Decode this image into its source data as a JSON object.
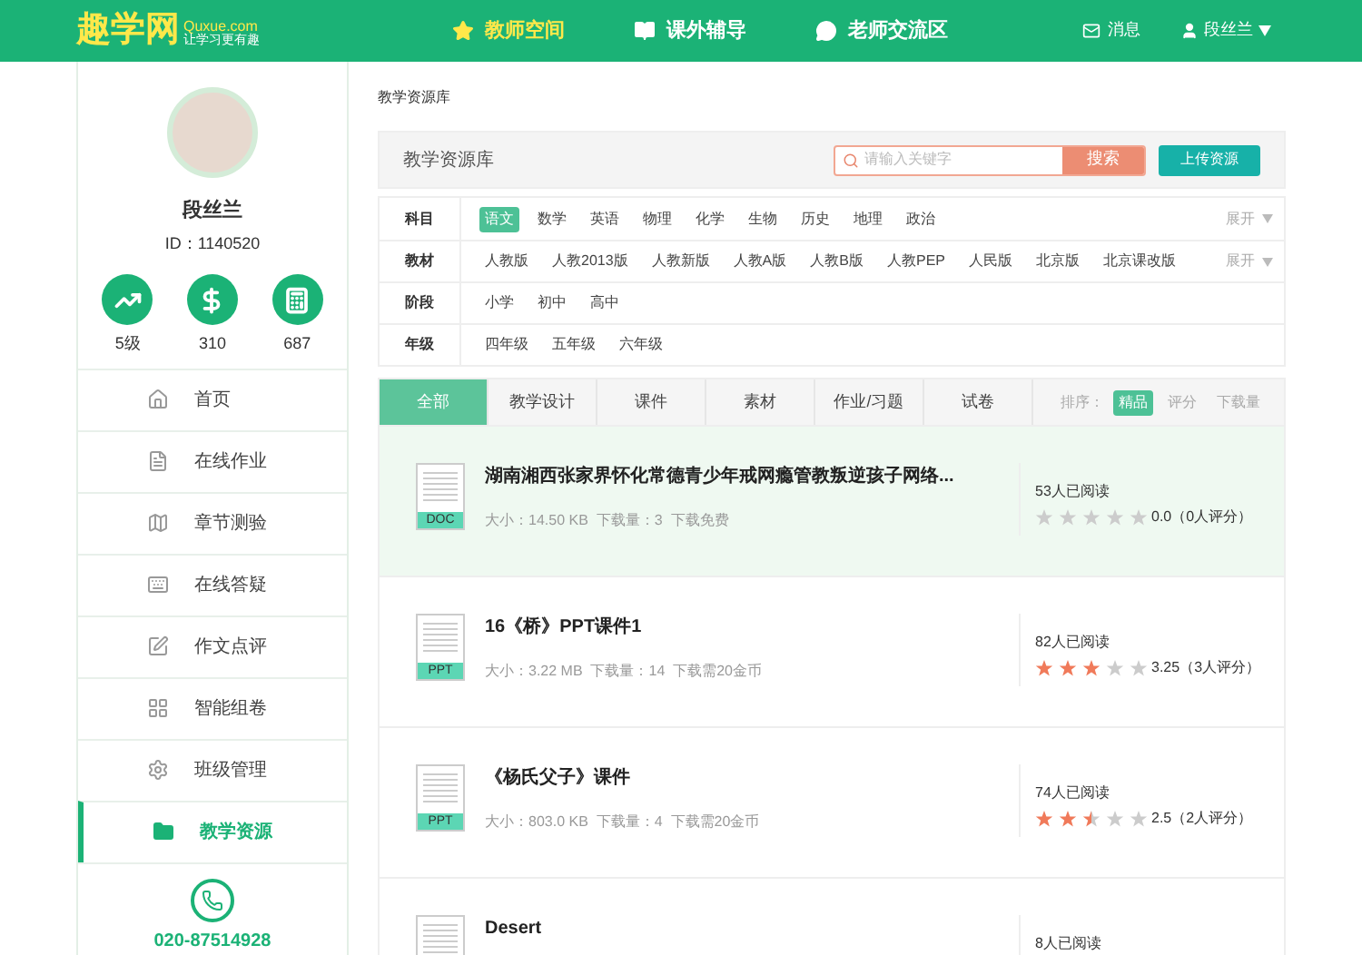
{
  "header": {
    "logo": {
      "name": "趣学网",
      "domain": "Quxue.com",
      "slogan": "让学习更有趣"
    },
    "nav": [
      {
        "label": "教师空间",
        "selected": true
      },
      {
        "label": "课外辅导",
        "selected": false
      },
      {
        "label": "老师交流区",
        "selected": false
      }
    ],
    "messages": "消息",
    "user": "段丝兰"
  },
  "sidebar": {
    "name": "段丝兰",
    "id": "ID：1140520",
    "stats": [
      {
        "value": "5级"
      },
      {
        "value": "310"
      },
      {
        "value": "687"
      }
    ],
    "menu": [
      {
        "label": "首页",
        "selected": false
      },
      {
        "label": "在线作业",
        "selected": false
      },
      {
        "label": "章节测验",
        "selected": false
      },
      {
        "label": "在线答疑",
        "selected": false
      },
      {
        "label": "作文点评",
        "selected": false
      },
      {
        "label": "智能组卷",
        "selected": false
      },
      {
        "label": "班级管理",
        "selected": false
      },
      {
        "label": "教学资源",
        "selected": true
      }
    ],
    "phone": "020-87514928"
  },
  "breadcrumb": "教学资源库",
  "search_panel": {
    "title": "教学资源库",
    "placeholder": "请输入关键字",
    "search_button": "搜索",
    "upload_button": "上传资源"
  },
  "filters": [
    {
      "label": "科目",
      "expand": "展开",
      "options": [
        {
          "label": "语文",
          "selected": true
        },
        {
          "label": "数学",
          "selected": false
        },
        {
          "label": "英语",
          "selected": false
        },
        {
          "label": "物理",
          "selected": false
        },
        {
          "label": "化学",
          "selected": false
        },
        {
          "label": "生物",
          "selected": false
        },
        {
          "label": "历史",
          "selected": false
        },
        {
          "label": "地理",
          "selected": false
        },
        {
          "label": "政治",
          "selected": false
        }
      ]
    },
    {
      "label": "教材",
      "expand": "展开",
      "options": [
        {
          "label": "人教版",
          "selected": false
        },
        {
          "label": "人教2013版",
          "selected": false
        },
        {
          "label": "人教新版",
          "selected": false
        },
        {
          "label": "人教A版",
          "selected": false
        },
        {
          "label": "人教B版",
          "selected": false
        },
        {
          "label": "人教PEP",
          "selected": false
        },
        {
          "label": "人民版",
          "selected": false
        },
        {
          "label": "北京版",
          "selected": false
        },
        {
          "label": "北京课改版",
          "selected": false
        }
      ]
    },
    {
      "label": "阶段",
      "options": [
        {
          "label": "小学",
          "selected": false
        },
        {
          "label": "初中",
          "selected": false
        },
        {
          "label": "高中",
          "selected": false
        }
      ]
    },
    {
      "label": "年级",
      "options": [
        {
          "label": "四年级",
          "selected": false
        },
        {
          "label": "五年级",
          "selected": false
        },
        {
          "label": "六年级",
          "selected": false
        }
      ]
    }
  ],
  "tabs": [
    {
      "label": "全部",
      "selected": true
    },
    {
      "label": "教学设计",
      "selected": false
    },
    {
      "label": "课件",
      "selected": false
    },
    {
      "label": "素材",
      "selected": false
    },
    {
      "label": "作业/习题",
      "selected": false
    },
    {
      "label": "试卷",
      "selected": false
    }
  ],
  "sort": {
    "label": "排序：",
    "options": [
      {
        "label": "精品",
        "selected": true
      },
      {
        "label": "评分",
        "selected": false
      },
      {
        "label": "下载量",
        "selected": false
      }
    ]
  },
  "resources": [
    {
      "type": "DOC",
      "title": "湖南湘西张家界怀化常德青少年戒网瘾管教叛逆孩子网络...",
      "meta": "大小：14.50 KB  下载量：3  下载免费",
      "reads": "53人已阅读",
      "stars": 0,
      "rating": "0.0（0人评分）",
      "highlighted": true
    },
    {
      "type": "PPT",
      "title": "16《桥》PPT课件1",
      "meta": "大小：3.22 MB  下载量：14  下载需20金币",
      "reads": "82人已阅读",
      "stars": 3,
      "rating": "3.25（3人评分）",
      "highlighted": false
    },
    {
      "type": "PPT",
      "title": "《杨氏父子》课件",
      "meta": "大小：803.0 KB  下载量：4  下载需20金币",
      "reads": "74人已阅读",
      "stars": 2.5,
      "rating": "2.5（2人评分）",
      "highlighted": false
    },
    {
      "title": "Desert",
      "reads": "8人已阅读",
      "highlighted": false
    }
  ]
}
